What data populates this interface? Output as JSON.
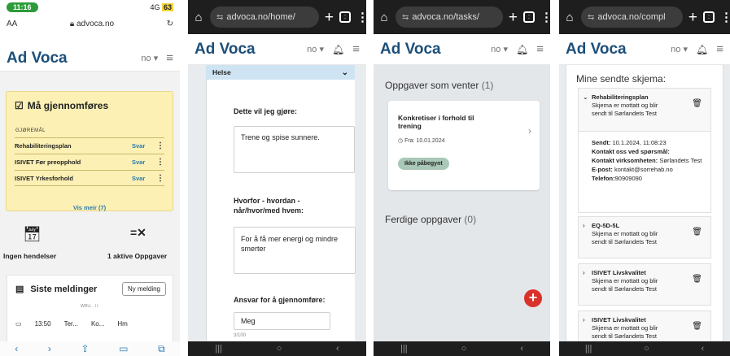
{
  "phone1": {
    "status": {
      "time": "11:16",
      "signal": "4G",
      "battery": "63"
    },
    "browser": {
      "text_size": "AA",
      "url": "advoca.no",
      "reload": "↻"
    },
    "app": {
      "logo": "Ad Voca",
      "lang": "no ▾",
      "menu": "≡"
    },
    "todo": {
      "title": "Må gjennomføres",
      "col_label": "GJØREMÅL",
      "rows": [
        {
          "name": "Rehabiliteringsplan",
          "action": "Svar"
        },
        {
          "name": "ISIVET Før preopphold",
          "action": "Svar"
        },
        {
          "name": "ISIVET Yrkesforhold",
          "action": "Svar"
        }
      ],
      "show_more": "Vis meir (7)"
    },
    "events": {
      "label": "Ingen hendelser"
    },
    "tasks": {
      "label": "1 aktive Oppgaver"
    },
    "messages": {
      "title": "Siste meldinger",
      "new_button": "Ny melding",
      "sub": "WRU...  I      I",
      "row": {
        "time": "13:50",
        "a": "Ter...",
        "b": "Ko...",
        "c": "Hm"
      }
    },
    "bottombar": [
      "‹",
      "›",
      "⇧",
      "▭",
      "⧉"
    ]
  },
  "phone2": {
    "url": "advoca.no/home/",
    "app": {
      "logo": "Ad Voca",
      "lang": "no ▾"
    },
    "accordion": "Helse",
    "q1": "Dette vil jeg gjøre:",
    "a1": "Trene og spise sunnere.",
    "q2": "Hvorfor - hvordan - når/hvor/med hvem:",
    "a2": "For å få mer energi og mindre smerter",
    "q3": "Ansvar for å gjennomføre:",
    "a3": "Meg",
    "count3": "3/100"
  },
  "phone3": {
    "url": "advoca.no/tasks/",
    "app": {
      "logo": "Ad Voca",
      "lang": "no ▾"
    },
    "pending": {
      "title": "Oppgaver som venter",
      "count": "(1)"
    },
    "task": {
      "title": "Konkretiser i forhold til trening",
      "from": "Fra: 10.01.2024",
      "status": "Ikke påbegynt"
    },
    "done": {
      "title": "Ferdige oppgaver",
      "count": "(0)"
    }
  },
  "phone4": {
    "url": "advoca.no/compl",
    "app": {
      "logo": "Ad Voca",
      "lang": "no ▾"
    },
    "title": "Mine sendte skjema:",
    "items": [
      {
        "name": "Rehabiliteringsplan",
        "desc": "Skjema er mottatt og blir sendt til Sørlandets Test"
      },
      {
        "name": "EQ-5D-5L",
        "desc": "Skjema er mottatt og blir sendt til Sørlandets Test"
      },
      {
        "name": "ISIVET Livskvalitet",
        "desc": "Skjema er mottatt og blir sendt til Sørlandets Test"
      },
      {
        "name": "ISIVET Livskvalitet",
        "desc": "Skjema er mottatt og blir sendt til Sørlandets Test"
      }
    ],
    "detail": {
      "sent_label": "Sendt:",
      "sent": "10.1.2024, 11:08:23",
      "q_label": "Kontakt oss ved spørsmål:",
      "company_label": "Kontakt virksomheten:",
      "company": "Sørlandets Test",
      "email_label": "E-post:",
      "email": "kontakt@sorrehab.no",
      "phone_label": "Telefon:",
      "phone": "90909090"
    }
  }
}
